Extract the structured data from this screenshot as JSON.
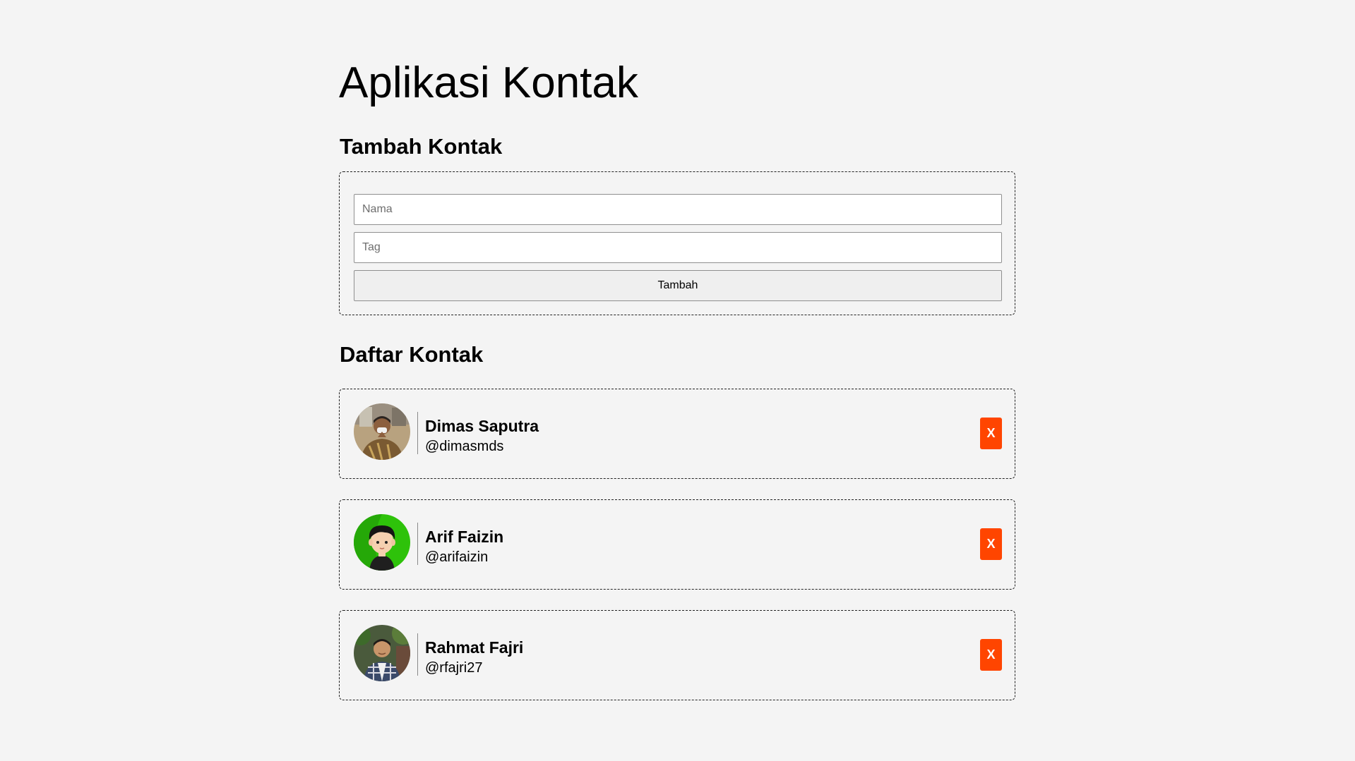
{
  "app": {
    "title": "Aplikasi Kontak"
  },
  "add_section": {
    "title": "Tambah Kontak",
    "name_placeholder": "Nama",
    "name_value": "",
    "tag_placeholder": "Tag",
    "tag_value": "",
    "submit_label": "Tambah"
  },
  "list_section": {
    "title": "Daftar Kontak",
    "contacts": [
      {
        "name": "Dimas Saputra",
        "tag": "@dimasmds",
        "avatar": "photo-avatar-icon",
        "delete_label": "X"
      },
      {
        "name": "Arif Faizin",
        "tag": "@arifaizin",
        "avatar": "cartoon-avatar-icon",
        "delete_label": "X"
      },
      {
        "name": "Rahmat Fajri",
        "tag": "@rfajri27",
        "avatar": "photo-avatar-icon",
        "delete_label": "X"
      }
    ]
  },
  "colors": {
    "background": "#f4f4f4",
    "delete_button": "#ff4500",
    "avatar_green": "#2ec20a"
  }
}
